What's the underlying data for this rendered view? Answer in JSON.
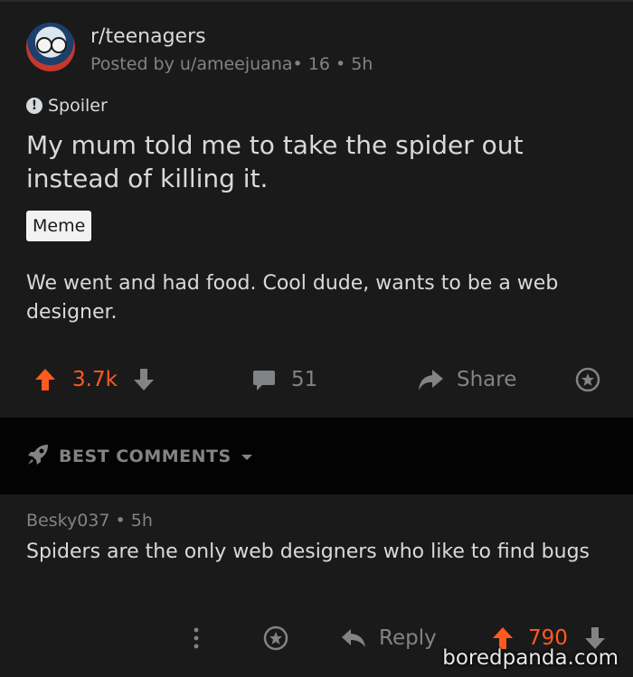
{
  "post": {
    "subreddit": "r/teenagers",
    "meta": "Posted by u/ameejuana• 16 • 5h",
    "spoiler_label": "Spoiler",
    "title": "My mum told me to take the spider out instead of killing it.",
    "flair": "Meme",
    "body": "We went and had food. Cool dude, wants to be a web designer.",
    "votes": "3.7k",
    "comments": "51",
    "share_label": "Share"
  },
  "sort": {
    "label": "BEST COMMENTS"
  },
  "comment": {
    "meta": "Besky037 • 5h",
    "body": "Spiders are the only web designers who like to find bugs",
    "reply_label": "Reply",
    "votes": "790"
  },
  "watermark": "boredpanda.com",
  "colors": {
    "background": "#1a1a1b",
    "band": "#030303",
    "text": "#d7dadc",
    "muted": "#818384",
    "upvote": "#ff5b1e"
  }
}
